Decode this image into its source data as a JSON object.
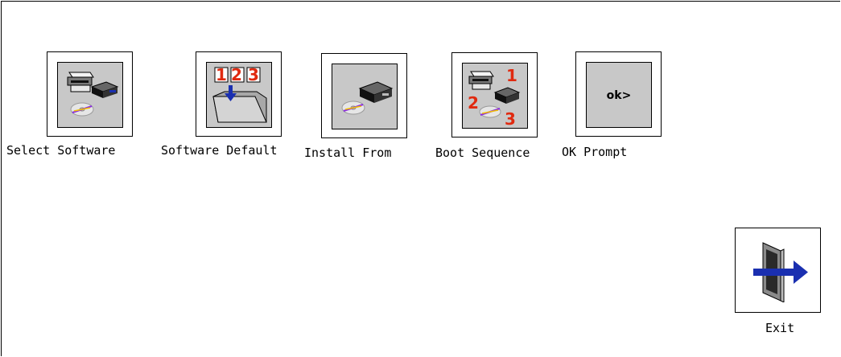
{
  "menu": {
    "items": [
      {
        "label": "Select Software",
        "icon": "select-software-icon"
      },
      {
        "label": "Software Default",
        "icon": "software-default-icon"
      },
      {
        "label": "Install From",
        "icon": "install-from-icon"
      },
      {
        "label": "Boot Sequence",
        "icon": "boot-sequence-icon"
      },
      {
        "label": "OK Prompt",
        "icon": "ok-prompt-icon",
        "icon_text": "ok>"
      }
    ],
    "exit": {
      "label": "Exit",
      "icon": "exit-icon"
    }
  },
  "boot_sequence_numbers": [
    "1",
    "2",
    "3"
  ],
  "software_default_numbers": [
    "1",
    "2",
    "3"
  ],
  "colors": {
    "background": "#ffffff",
    "icon_face": "#c8c8c8",
    "accent_red": "#e02a10",
    "arrow_blue": "#1a2fb0"
  }
}
